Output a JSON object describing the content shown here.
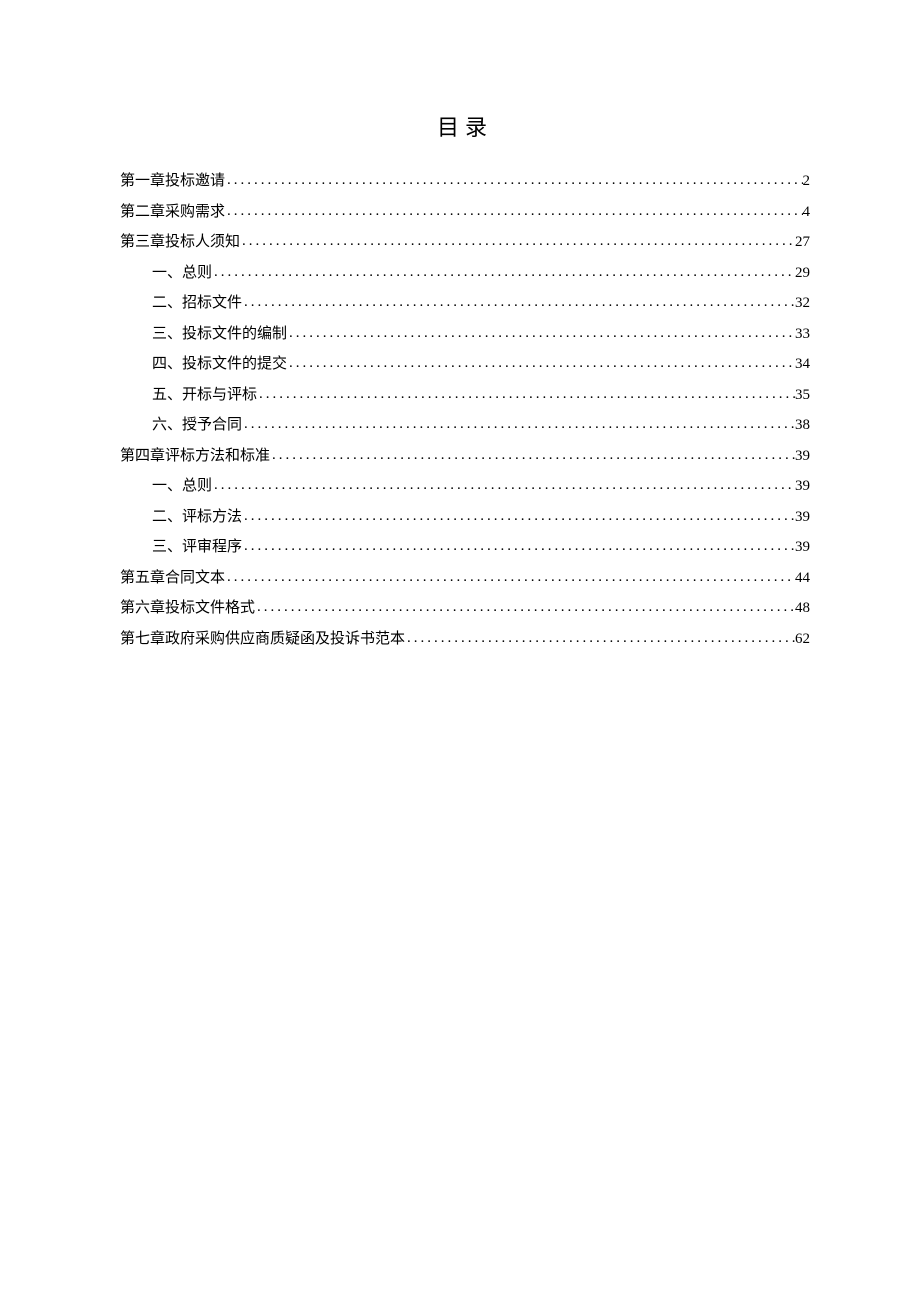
{
  "title": "目录",
  "entries": [
    {
      "label": "第一章投标邀请",
      "page": "2",
      "level": 1
    },
    {
      "label": "第二章采购需求",
      "page": "4",
      "level": 1
    },
    {
      "label": "第三章投标人须知",
      "page": "27",
      "level": 1
    },
    {
      "label": "一、总则",
      "page": "29",
      "level": 2
    },
    {
      "label": "二、招标文件",
      "page": "32",
      "level": 2
    },
    {
      "label": "三、投标文件的编制",
      "page": "33",
      "level": 2
    },
    {
      "label": "四、投标文件的提交",
      "page": "34",
      "level": 2
    },
    {
      "label": "五、开标与评标",
      "page": "35",
      "level": 2
    },
    {
      "label": "六、授予合同",
      "page": "38",
      "level": 2
    },
    {
      "label": "第四章评标方法和标准",
      "page": "39",
      "level": 1
    },
    {
      "label": "一、总则",
      "page": "39",
      "level": 2
    },
    {
      "label": "二、评标方法",
      "page": "39",
      "level": 2
    },
    {
      "label": "三、评审程序",
      "page": "39",
      "level": 2
    },
    {
      "label": "第五章合同文本",
      "page": "44",
      "level": 1
    },
    {
      "label": "第六章投标文件格式",
      "page": "48",
      "level": 1
    },
    {
      "label": "第七章政府采购供应商质疑函及投诉书范本",
      "page": "62",
      "level": 1
    }
  ]
}
